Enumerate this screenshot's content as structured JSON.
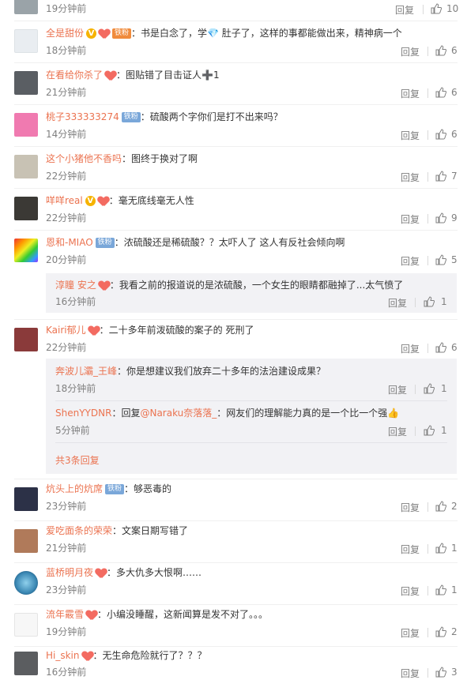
{
  "comments": [
    {
      "user": "",
      "text": "",
      "time": "19分钟前",
      "reply": "回复",
      "likes": "10",
      "badges": []
    },
    {
      "user": "全是甜份",
      "text": "书是白念了，学💎 肚子了，这样的事都能做出来，精神病一个",
      "time": "18分钟前",
      "reply": "回复",
      "likes": "6",
      "badges": [
        "v",
        "heart-orange"
      ]
    },
    {
      "user": "在看给你杀了",
      "text": "图贴错了目击证人➕1",
      "time": "21分钟前",
      "reply": "回复",
      "likes": "6",
      "badges": [
        "heart"
      ]
    },
    {
      "user": "桃子333333274",
      "text": "硫酸两个字你们是打不出来吗？",
      "time": "14分钟前",
      "reply": "回复",
      "likes": "6",
      "badges": [
        "fan"
      ]
    },
    {
      "user": "这个小猪他不香吗",
      "text": "图终于换对了啊",
      "time": "22分钟前",
      "reply": "回复",
      "likes": "7",
      "badges": []
    },
    {
      "user": "咩咩real",
      "text": "毫无底线毫无人性",
      "time": "22分钟前",
      "reply": "回复",
      "likes": "9",
      "badges": [
        "v",
        "heart"
      ]
    },
    {
      "user": "恩和-MIAO",
      "text": "浓硫酸还是稀硫酸？？太吓人了 这人有反社会倾向啊",
      "time": "20分钟前",
      "reply": "回复",
      "likes": "5",
      "badges": [
        "fan"
      ]
    },
    {
      "user": "Kairi郁儿",
      "text": "二十多年前泼硫酸的案子的 死刑了",
      "time": "22分钟前",
      "reply": "回复",
      "likes": "6",
      "badges": [
        "heart"
      ]
    },
    {
      "user": "炕头上的炕席",
      "text": "够恶毒的",
      "time": "23分钟前",
      "reply": "回复",
      "likes": "2",
      "badges": [
        "fan"
      ]
    },
    {
      "user": "爱吃面条的荣荣",
      "text": "文案日期写错了",
      "time": "21分钟前",
      "reply": "回复",
      "likes": "1",
      "badges": []
    },
    {
      "user": "蓝桥明月夜",
      "text": "多大仇多大恨啊……",
      "time": "23分钟前",
      "reply": "回复",
      "likes": "1",
      "badges": [
        "heart"
      ]
    },
    {
      "user": "流年霰雪",
      "text": "小编没睡醒，这新闻算是发不对了。。。",
      "time": "19分钟前",
      "reply": "回复",
      "likes": "2",
      "badges": [
        "heart"
      ]
    },
    {
      "user": "Hi_skin",
      "text": "无生命危险就行了？？？",
      "time": "16分钟前",
      "reply": "回复",
      "likes": "3",
      "badges": [
        "heart"
      ]
    }
  ],
  "sub_miao": {
    "user": "淳瞳 安之",
    "text": "我看之前的报道说的是浓硫酸，一个女生的眼睛都融掉了...太气愤了",
    "time": "16分钟前",
    "reply": "回复",
    "likes": "1"
  },
  "sub_kairi": [
    {
      "user": "奔波儿灞_王峰",
      "text": "你是想建议我们放弃二十多年的法治建设成果？",
      "time": "18分钟前",
      "reply": "回复",
      "likes": "1"
    },
    {
      "user": "ShenYYDNR",
      "text_prefix": "回复",
      "mention": "@Naraku奈落落_",
      "text": "网友们的理解能力真的是一个比一个强👍",
      "time": "5分钟前",
      "reply": "回复",
      "likes": "1"
    }
  ],
  "sub_kairi_more": "共3条回复",
  "colors": {
    "username": "#eb7350",
    "secondary": "#808080",
    "panel": "#f2f2f5"
  }
}
